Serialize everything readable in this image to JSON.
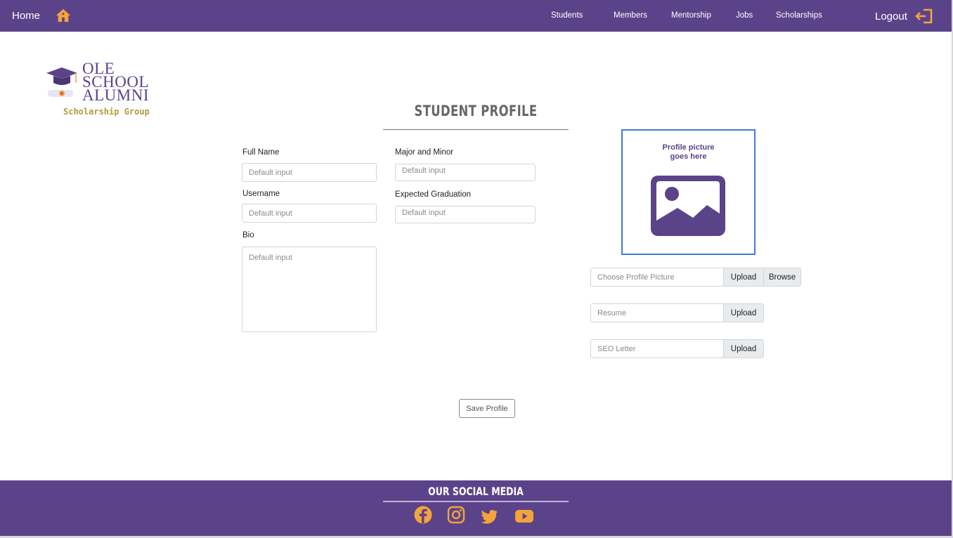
{
  "header": {
    "home_label": "Home",
    "nav": [
      "Students",
      "Members",
      "Mentorship",
      "Jobs",
      "Scholarships"
    ],
    "logout_label": "Logout",
    "home_icon": "home-icon",
    "logout_icon": "logout-icon"
  },
  "logo": {
    "lines": [
      "OLE",
      "SCHOOL",
      "ALUMNI"
    ],
    "subtitle": "Scholarship Group"
  },
  "page": {
    "title": "STUDENT PROFILE"
  },
  "form": {
    "full_name": {
      "label": "Full Name",
      "placeholder": "Default input"
    },
    "username": {
      "label": "Username",
      "placeholder": "Default input"
    },
    "bio": {
      "label": "Bio",
      "placeholder": "Default input"
    },
    "major_minor": {
      "label": "Major and Minor",
      "placeholder": "Default input"
    },
    "expected_graduation": {
      "label": "Expected Graduation",
      "placeholder": "Default input"
    },
    "save_label": "Save Profile"
  },
  "profile_picture": {
    "caption_line1": "Profile picture",
    "caption_line2": "goes here",
    "icon": "image-placeholder-icon"
  },
  "uploads": {
    "picture": {
      "placeholder": "Choose Profile Picture",
      "upload_label": "Upload",
      "browse_label": "Browse"
    },
    "resume": {
      "placeholder": "Resume",
      "upload_label": "Upload"
    },
    "seo_letter": {
      "placeholder": "SEO Letter",
      "upload_label": "Upload"
    }
  },
  "footer": {
    "title": "OUR SOCIAL MEDIA",
    "icons": [
      "facebook-icon",
      "instagram-icon",
      "twitter-icon",
      "youtube-icon"
    ]
  },
  "colors": {
    "brand_purple": "#5b438a",
    "accent_orange": "#f5a33a",
    "frame_blue": "#3f7ad8",
    "logo_gold": "#b19a3a"
  }
}
